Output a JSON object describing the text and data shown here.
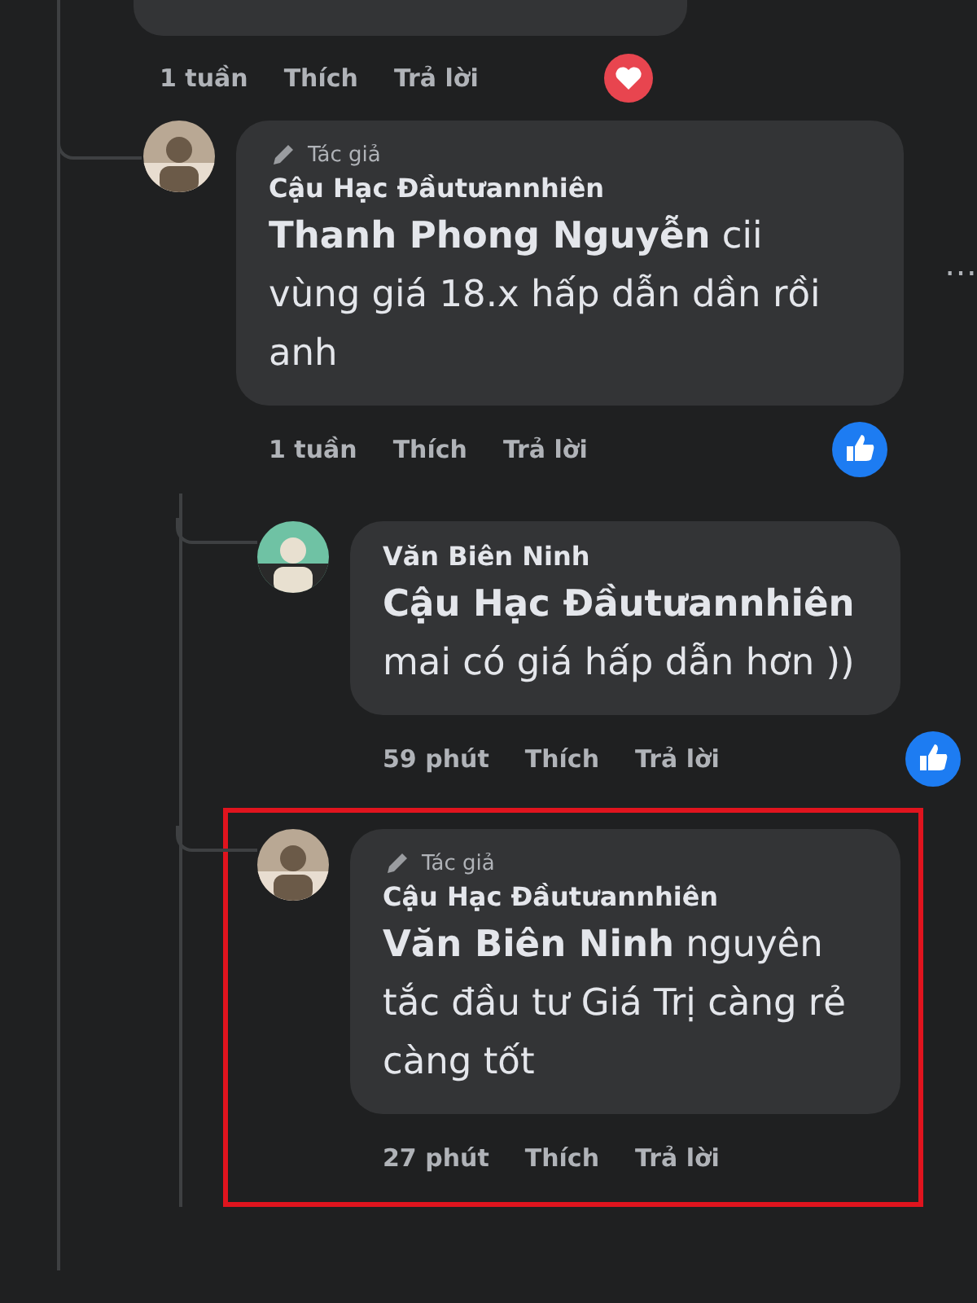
{
  "top_comment": {
    "time": "1 tuần",
    "like": "Thích",
    "reply": "Trả lời",
    "reaction": {
      "kind": "heart"
    }
  },
  "replies": [
    {
      "badge": "Tác giả",
      "name": "Cậu Hạc Đầutưannhiên",
      "text": "**Thanh Phong Nguyễn** cii vùng giá 18.x hấp dẫn dần rồi anh",
      "time": "1 tuần",
      "like": "Thích",
      "reply": "Trả lời",
      "reaction": {
        "kind": "like"
      },
      "more": "…",
      "children": [
        {
          "name": "Văn Biên Ninh",
          "text": "**Cậu Hạc Đầutưannhiên** mai có giá hấp dẫn hơn ))",
          "time": "59 phút",
          "like": "Thích",
          "reply": "Trả lời",
          "reaction": {
            "kind": "like"
          },
          "highlighted": false
        },
        {
          "badge": "Tác giả",
          "name": "Cậu Hạc Đầutưannhiên",
          "text": "**Văn Biên Ninh** nguyên tắc đầu tư Giá Trị càng rẻ càng tốt",
          "time": "27 phút",
          "like": "Thích",
          "reply": "Trả lời",
          "highlighted": true
        }
      ]
    }
  ]
}
